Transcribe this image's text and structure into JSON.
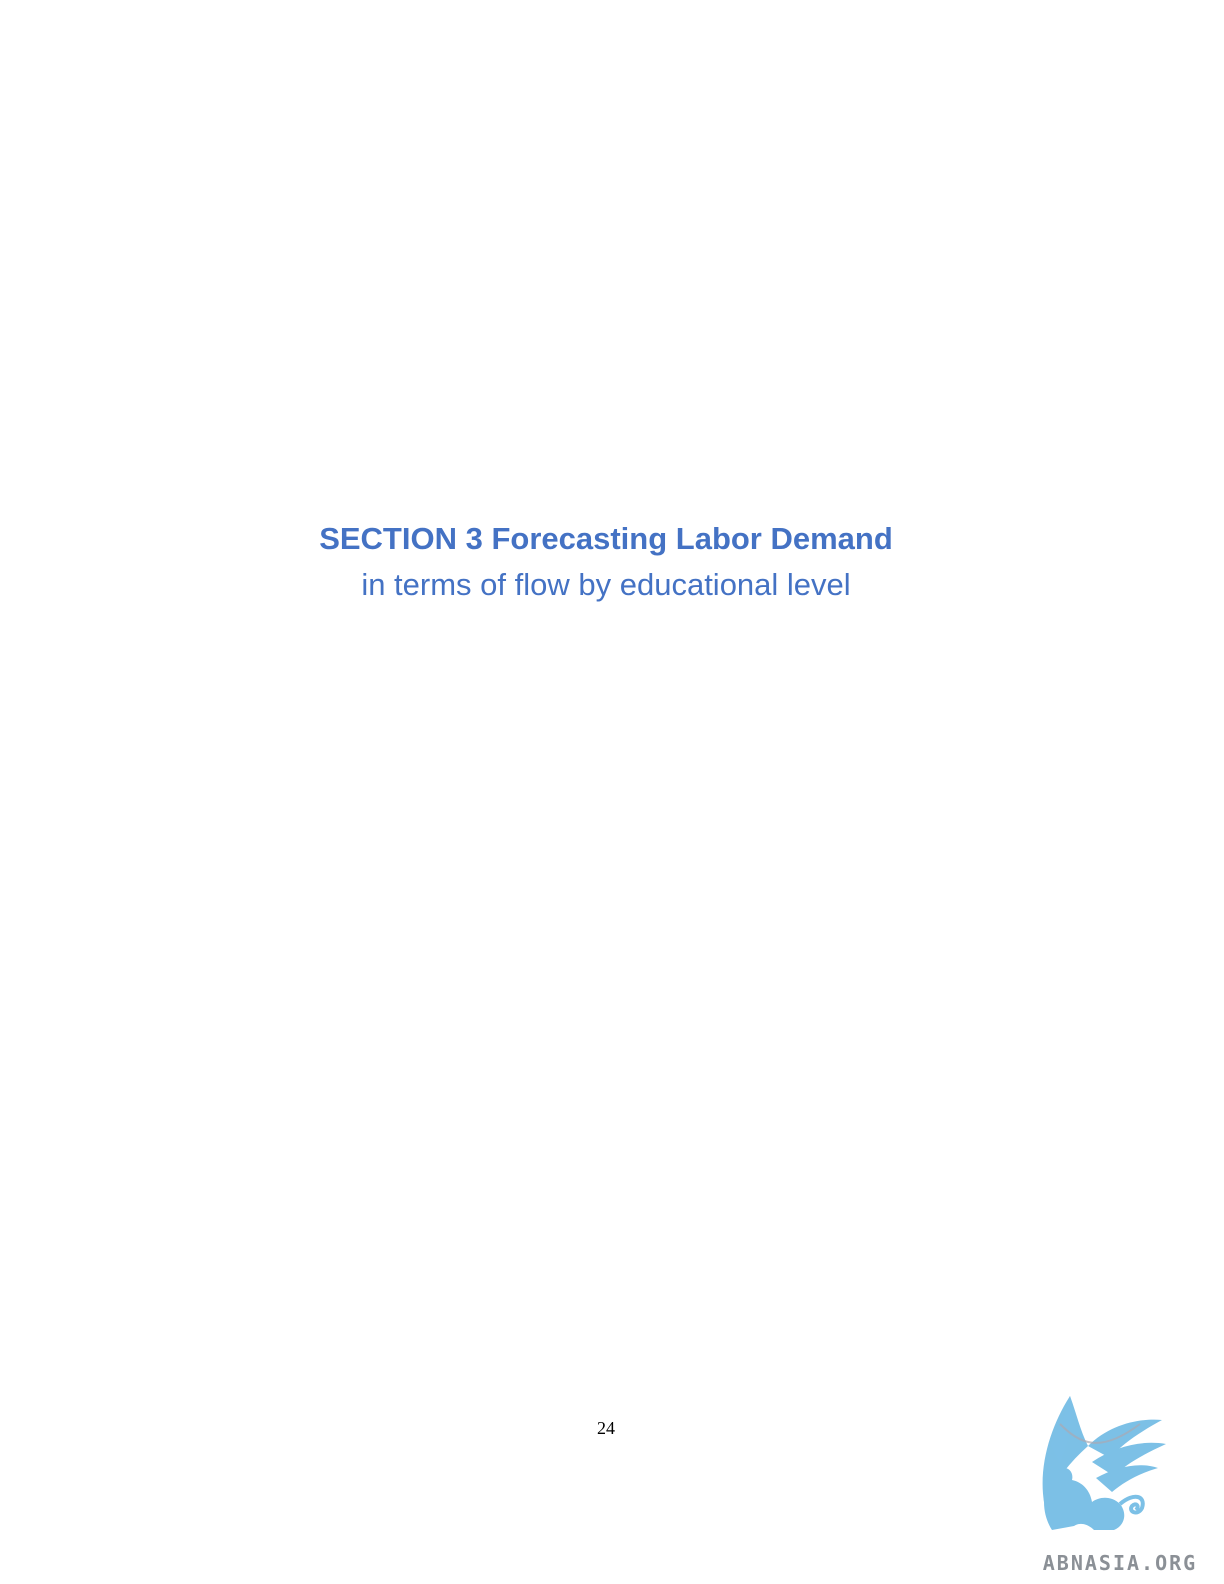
{
  "section": {
    "title": "SECTION 3 Forecasting Labor Demand",
    "subtitle": "in terms of flow by educational level"
  },
  "footer": {
    "page_number": "24"
  },
  "watermark": {
    "text": "ABNASIA.ORG",
    "icon": "griffin-logo-icon",
    "color": "#7cc0e6"
  },
  "colors": {
    "heading": "#4472c4"
  }
}
